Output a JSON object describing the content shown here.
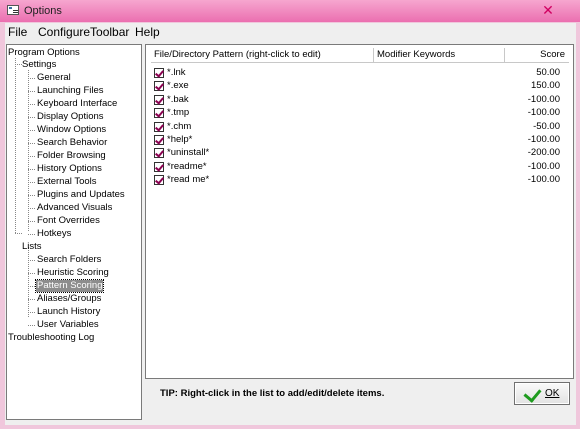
{
  "window": {
    "title": "Options",
    "close_glyph": "✕"
  },
  "menu": [
    "File",
    "ConfigureToolbar",
    "Help"
  ],
  "tree": {
    "root": "Program Options",
    "settings_label": "Settings",
    "settings": [
      "General",
      "Launching Files",
      "Keyboard Interface",
      "Display Options",
      "Window Options",
      "Search Behavior",
      "Folder Browsing",
      "History Options",
      "External Tools",
      "Plugins and Updates",
      "Advanced Visuals",
      "Font Overrides",
      "Hotkeys"
    ],
    "lists_label": "Lists",
    "lists": [
      "Search Folders",
      "Heuristic Scoring",
      "Pattern Scoring",
      "Aliases/Groups",
      "Launch History",
      "User Variables"
    ],
    "selected": "Pattern Scoring",
    "troubleshooting": "Troubleshooting Log"
  },
  "list": {
    "columns": [
      "File/Directory Pattern (right-click to edit)",
      "Modifier Keywords",
      "Score"
    ],
    "rows": [
      {
        "pattern": "*.lnk",
        "keywords": "",
        "score": "50.00",
        "checked": true
      },
      {
        "pattern": "*.exe",
        "keywords": "",
        "score": "150.00",
        "checked": true
      },
      {
        "pattern": "*.bak",
        "keywords": "",
        "score": "-100.00",
        "checked": true
      },
      {
        "pattern": "*.tmp",
        "keywords": "",
        "score": "-100.00",
        "checked": true
      },
      {
        "pattern": "*.chm",
        "keywords": "",
        "score": "-50.00",
        "checked": true
      },
      {
        "pattern": "*help*",
        "keywords": "",
        "score": "-100.00",
        "checked": true
      },
      {
        "pattern": "*uninstall*",
        "keywords": "",
        "score": "-200.00",
        "checked": true
      },
      {
        "pattern": "*readme*",
        "keywords": "",
        "score": "-100.00",
        "checked": true
      },
      {
        "pattern": "*read me*",
        "keywords": "",
        "score": "-100.00",
        "checked": true
      }
    ]
  },
  "tip": "TIP: Right-click in the list to add/edit/delete items.",
  "ok_button": {
    "label": "OK",
    "icon": "checkmark-icon"
  },
  "colors": {
    "accent": "#e8007a",
    "check": "#8a0050",
    "ok_check": "#1e9b1e"
  }
}
